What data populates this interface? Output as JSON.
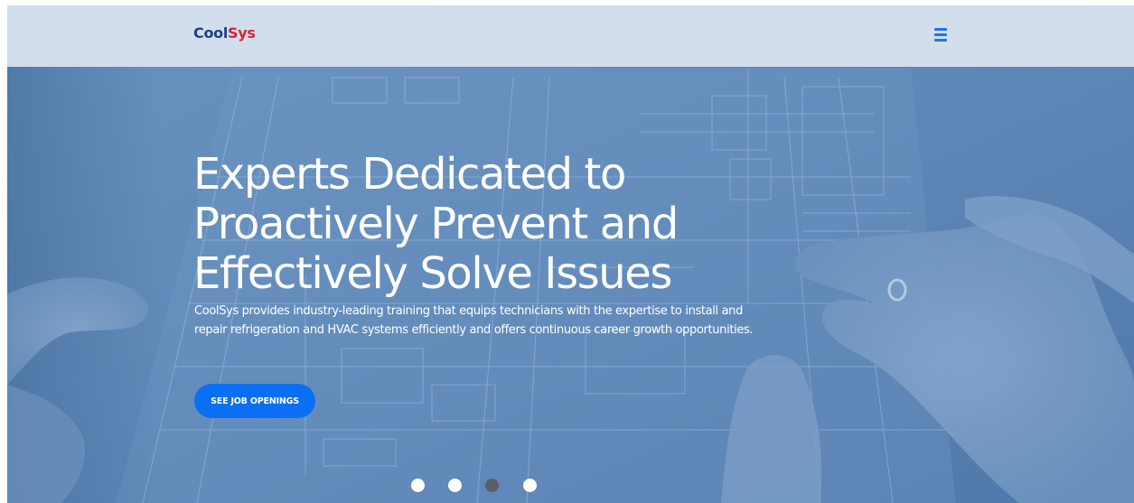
{
  "brand": {
    "logo_part1": "Cool",
    "logo_part2": "Sys",
    "logo_color_1": "#1f3f8e",
    "logo_color_2": "#d7262e"
  },
  "header": {
    "menu_icon": "hamburger-menu-icon",
    "accent_color": "#1f74e8"
  },
  "hero": {
    "title_lines": [
      "Experts Dedicated to",
      "Proactively Prevent and",
      "Effectively Solve Issues"
    ],
    "description": "CoolSys provides industry-leading training that equips technicians with the expertise to install and repair refrigeration and HVAC systems efficiently and offers continuous career growth opportunities.",
    "cta_label": "SEE JOB OPENINGS",
    "cta_color": "#0a6ff2"
  },
  "carousel": {
    "slides": 4,
    "active_index": 2
  }
}
